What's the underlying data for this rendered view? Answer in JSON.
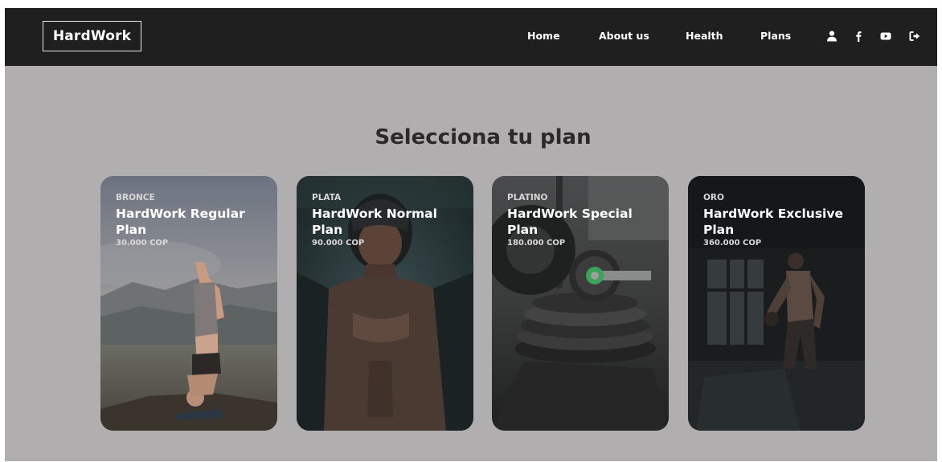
{
  "header": {
    "logo": "HardWork",
    "nav": [
      "Home",
      "About us",
      "Health",
      "Plans"
    ],
    "icons": [
      "user-icon",
      "facebook-icon",
      "youtube-icon",
      "logout-icon"
    ]
  },
  "main": {
    "title": "Selecciona tu plan",
    "plans": [
      {
        "tier": "BRONCE",
        "name": "HardWork Regular Plan",
        "price": "30.000 COP"
      },
      {
        "tier": "PLATA",
        "name": "HardWork Normal Plan",
        "price": "90.000 COP"
      },
      {
        "tier": "PLATINO",
        "name": "HardWork Special Plan",
        "price": "180.000 COP"
      },
      {
        "tier": "ORO",
        "name": "HardWork Exclusive Plan",
        "price": "360.000 COP"
      }
    ]
  },
  "colors": {
    "navbar": "#1f1f1f",
    "page_background": "#b1aeaf",
    "title": "#2a2a2a",
    "card_text": "#ffffff"
  }
}
